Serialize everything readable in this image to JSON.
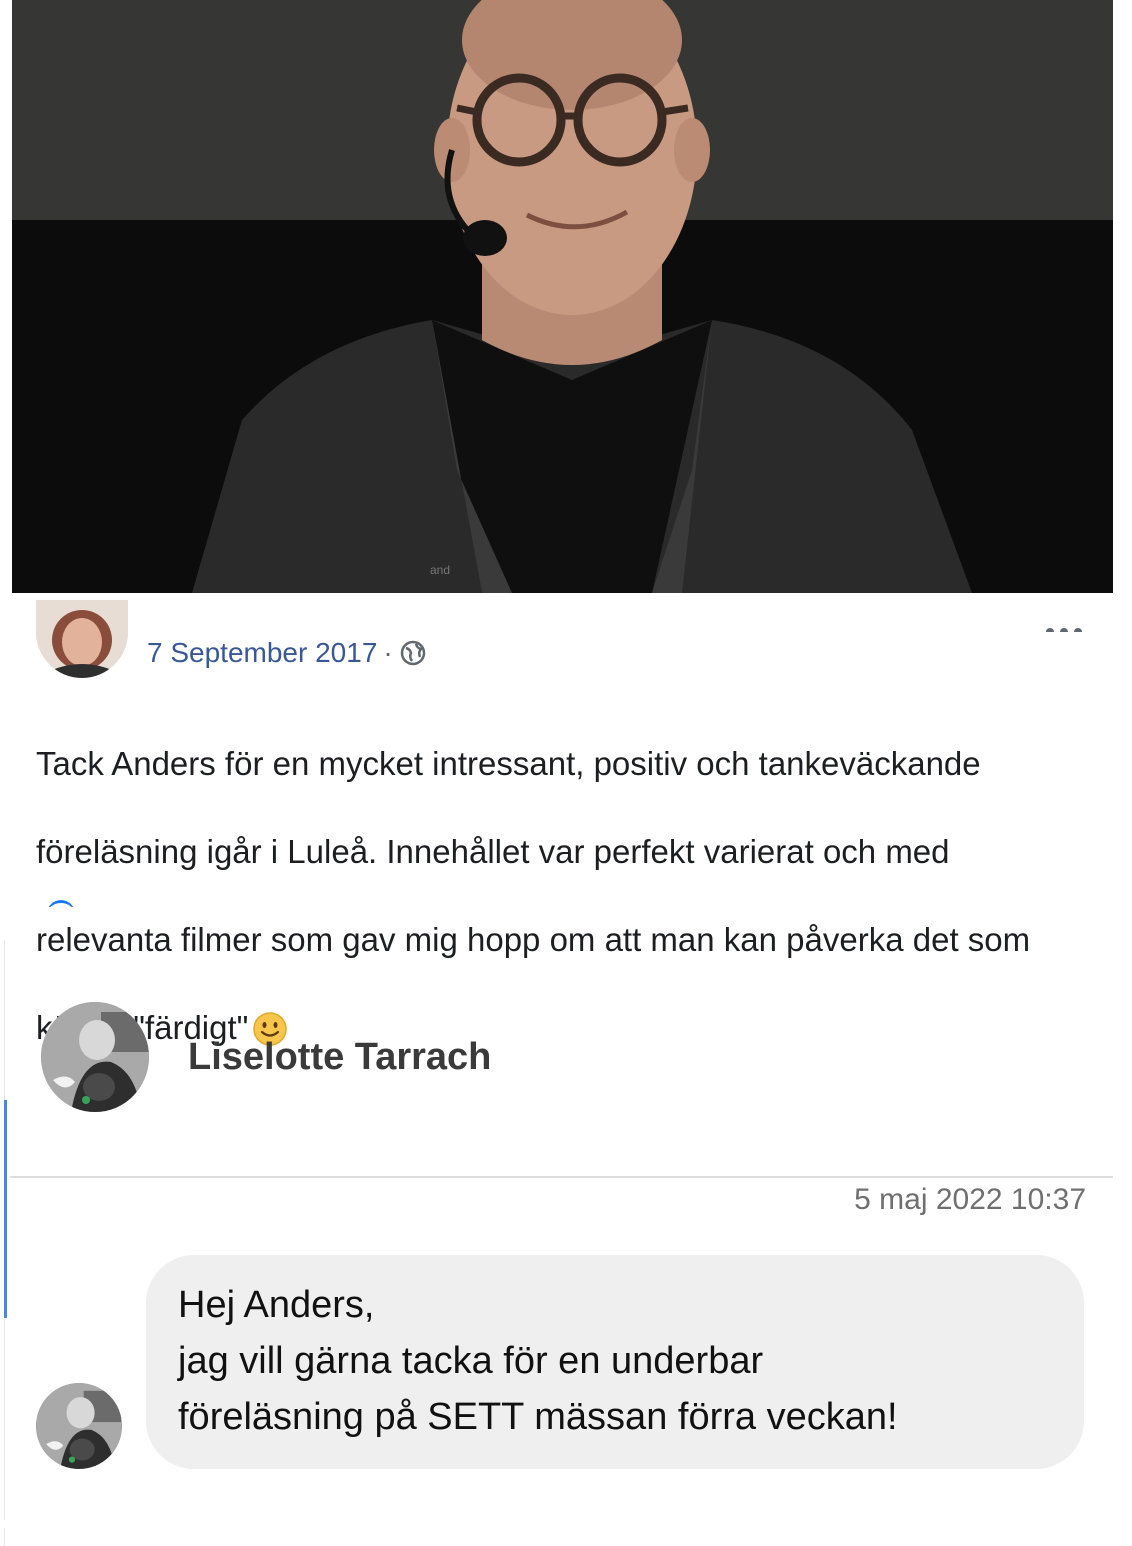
{
  "post": {
    "date": "7 September 2017",
    "separator": "·",
    "visibility_icon": "globe-icon",
    "more_icon": "ellipsis-icon",
    "text_line1": "Tack Anders för en mycket intressant, positiv och tankeväckande",
    "text_line2": "föreläsning igår i Luleå. Innehållet var perfekt varierat och med",
    "text_line3": "relevanta filmer som gav mig hopp om att man kan påverka det som",
    "text_line4": "känns \"färdigt\"",
    "emoji": "smiley-icon",
    "photo_caption_mark": "and"
  },
  "thread": {
    "sender_name": "Liselotte Tarrach",
    "timestamp": "5 maj 2022 10:37",
    "message_lines": [
      "Hej Anders,",
      "jag vill gärna tacka för en underbar",
      "föreläsning på SETT mässan förra veckan!"
    ]
  },
  "colors": {
    "link_blue": "#385898",
    "thread_accent": "#4f86d6",
    "bubble_bg": "#efefef"
  }
}
